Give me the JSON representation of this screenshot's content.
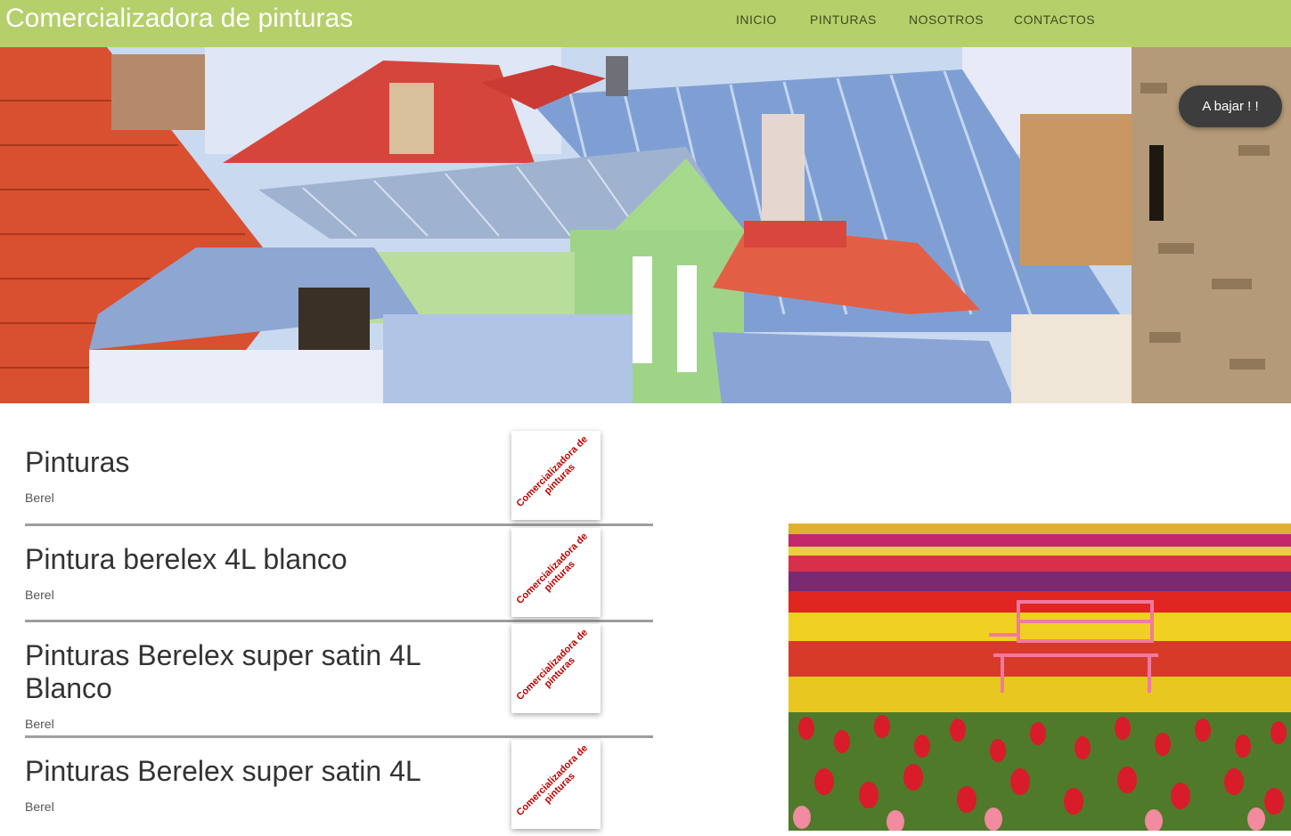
{
  "header": {
    "brand": "Comercializadora de pinturas",
    "nav": [
      "INICIO",
      "PINTURAS",
      "NOSOTROS",
      "CONTACTOS"
    ]
  },
  "hero": {
    "scroll_button": "A bajar ! !"
  },
  "products": [
    {
      "title": "Pinturas",
      "brand": "Berel",
      "thumb_text": "Comercializadora de pinturas"
    },
    {
      "title": "Pintura berelex 4L blanco",
      "brand": "Berel",
      "thumb_text": "Comercializadora de pinturas"
    },
    {
      "title": "Pinturas Berelex super satin 4L Blanco",
      "brand": "Berel",
      "thumb_text": "Comercializadora de pinturas"
    },
    {
      "title": "Pinturas Berelex super satin 4L",
      "brand": "Berel",
      "thumb_text": "Comercializadora de pinturas"
    }
  ],
  "colors": {
    "topbar": "#b5cf6b",
    "thumb_text": "#c00000",
    "scroll_button": "#3d3d3d"
  }
}
